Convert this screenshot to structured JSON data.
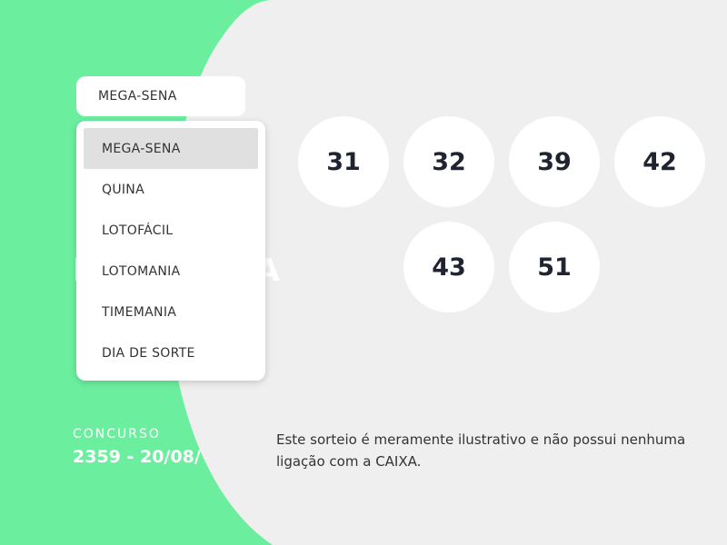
{
  "theme": {
    "accent": "#6bef9f",
    "panel": "#efefef",
    "ball_bg": "#ffffff",
    "ball_text": "#1f2430"
  },
  "lottery_select": {
    "selected_label": "MEGA-SENA",
    "options": [
      {
        "label": "MEGA-SENA",
        "selected": true
      },
      {
        "label": "QUINA",
        "selected": false
      },
      {
        "label": "LOTOFÁCIL",
        "selected": false
      },
      {
        "label": "LOTOMANIA",
        "selected": false
      },
      {
        "label": "TIMEMANIA",
        "selected": false
      },
      {
        "label": "DIA DE SORTE",
        "selected": false
      }
    ]
  },
  "concurso": {
    "label": "CONCURSO",
    "value": "2359 - 20/08/"
  },
  "numbers": [
    "31",
    "32",
    "39",
    "42",
    "43",
    "51"
  ],
  "disclaimer": "Este sorteio é meramente ilustrativo e não possui nenhuma ligação com a CAIXA."
}
